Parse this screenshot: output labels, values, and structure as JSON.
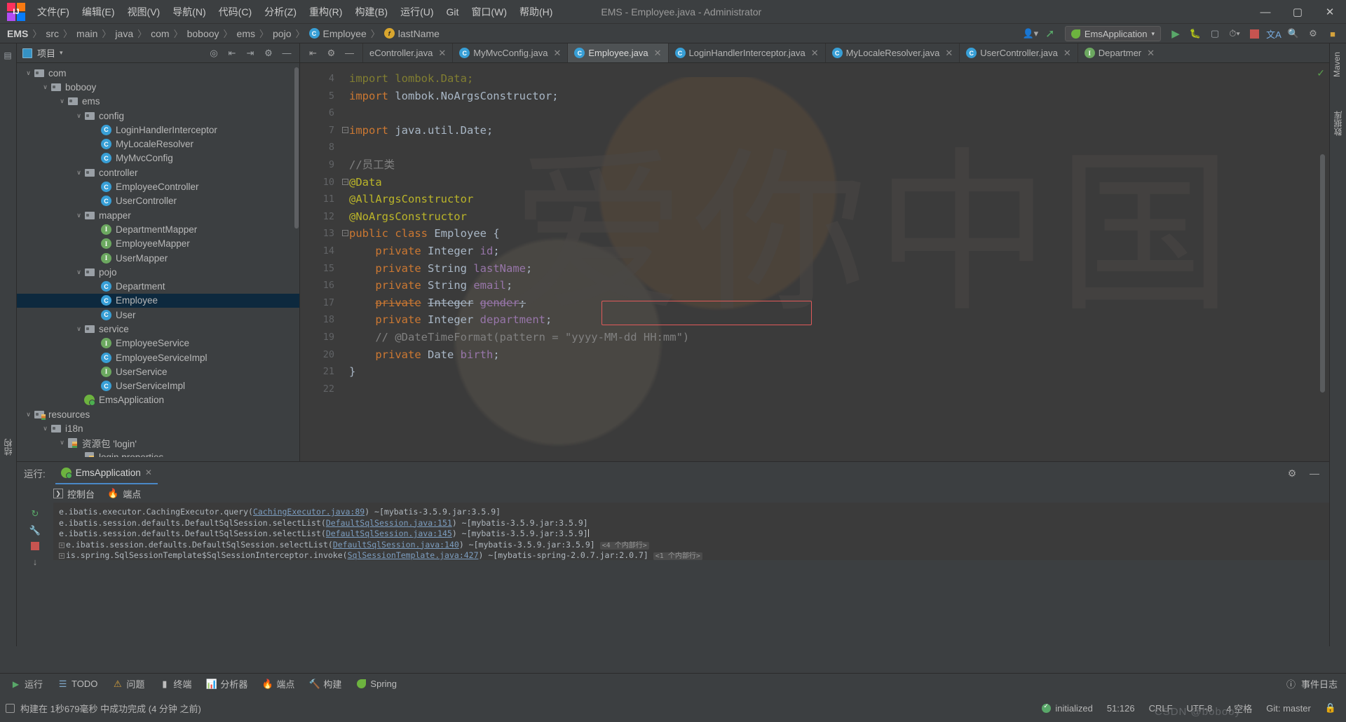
{
  "window": {
    "title": "EMS - Employee.java - Administrator",
    "minimize": "—",
    "maximize": "▢",
    "close": "✕"
  },
  "menubar": {
    "items": [
      {
        "label": "文件(F)"
      },
      {
        "label": "编辑(E)"
      },
      {
        "label": "视图(V)"
      },
      {
        "label": "导航(N)"
      },
      {
        "label": "代码(C)"
      },
      {
        "label": "分析(Z)"
      },
      {
        "label": "重构(R)"
      },
      {
        "label": "构建(B)"
      },
      {
        "label": "运行(U)"
      },
      {
        "label": "Git"
      },
      {
        "label": "窗口(W)"
      },
      {
        "label": "帮助(H)"
      }
    ]
  },
  "breadcrumb": {
    "items": [
      "EMS",
      "src",
      "main",
      "java",
      "com",
      "bobooy",
      "ems",
      "pojo",
      "Employee",
      "lastName"
    ],
    "class_icon": "C",
    "field_icon": "f",
    "separator": "〉"
  },
  "navbar_right": {
    "run_config": "EmsApplication",
    "icons": [
      "user-icon",
      "hammer-icon",
      "run-icon",
      "debug-icon",
      "coverage-icon",
      "profile-icon",
      "stop-icon",
      "translate-icon",
      "search-icon",
      "settings-icon",
      "plugin-icon"
    ]
  },
  "left_strip": {
    "tabs": [
      "项目",
      "结构"
    ]
  },
  "right_strip": {
    "tabs": [
      "Maven",
      "数据库"
    ]
  },
  "project_panel": {
    "title": "项目",
    "caret": "▾",
    "tools": [
      "target-icon",
      "collapse-icon",
      "expand-icon",
      "gear-icon",
      "minimize-icon"
    ],
    "tree": [
      {
        "depth": 3,
        "arrow": "∨",
        "icon": "folder",
        "label": "com",
        "selected": false
      },
      {
        "depth": 4,
        "arrow": "∨",
        "icon": "folder",
        "label": "bobooy",
        "selected": false
      },
      {
        "depth": 5,
        "arrow": "∨",
        "icon": "folder",
        "label": "ems",
        "selected": false
      },
      {
        "depth": 6,
        "arrow": "∨",
        "icon": "folder",
        "label": "config",
        "selected": false
      },
      {
        "depth": 7,
        "arrow": "",
        "icon": "class",
        "label": "LoginHandlerInterceptor",
        "selected": false
      },
      {
        "depth": 7,
        "arrow": "",
        "icon": "class",
        "label": "MyLocaleResolver",
        "selected": false
      },
      {
        "depth": 7,
        "arrow": "",
        "icon": "class",
        "label": "MyMvcConfig",
        "selected": false
      },
      {
        "depth": 6,
        "arrow": "∨",
        "icon": "folder",
        "label": "controller",
        "selected": false
      },
      {
        "depth": 7,
        "arrow": "",
        "icon": "class",
        "label": "EmployeeController",
        "selected": false
      },
      {
        "depth": 7,
        "arrow": "",
        "icon": "class",
        "label": "UserController",
        "selected": false
      },
      {
        "depth": 6,
        "arrow": "∨",
        "icon": "folder",
        "label": "mapper",
        "selected": false
      },
      {
        "depth": 7,
        "arrow": "",
        "icon": "interface",
        "label": "DepartmentMapper",
        "selected": false
      },
      {
        "depth": 7,
        "arrow": "",
        "icon": "interface",
        "label": "EmployeeMapper",
        "selected": false
      },
      {
        "depth": 7,
        "arrow": "",
        "icon": "interface",
        "label": "UserMapper",
        "selected": false
      },
      {
        "depth": 6,
        "arrow": "∨",
        "icon": "folder",
        "label": "pojo",
        "selected": false
      },
      {
        "depth": 7,
        "arrow": "",
        "icon": "class",
        "label": "Department",
        "selected": false
      },
      {
        "depth": 7,
        "arrow": "",
        "icon": "class",
        "label": "Employee",
        "selected": true
      },
      {
        "depth": 7,
        "arrow": "",
        "icon": "class",
        "label": "User",
        "selected": false
      },
      {
        "depth": 6,
        "arrow": "∨",
        "icon": "folder",
        "label": "service",
        "selected": false
      },
      {
        "depth": 7,
        "arrow": "",
        "icon": "interface",
        "label": "EmployeeService",
        "selected": false
      },
      {
        "depth": 7,
        "arrow": "",
        "icon": "class",
        "label": "EmployeeServiceImpl",
        "selected": false
      },
      {
        "depth": 7,
        "arrow": "",
        "icon": "interface",
        "label": "UserService",
        "selected": false
      },
      {
        "depth": 7,
        "arrow": "",
        "icon": "class",
        "label": "UserServiceImpl",
        "selected": false
      },
      {
        "depth": 6,
        "arrow": "",
        "icon": "spring",
        "label": "EmsApplication",
        "selected": false
      },
      {
        "depth": 3,
        "arrow": "∨",
        "icon": "resfolder",
        "label": "resources",
        "selected": false
      },
      {
        "depth": 4,
        "arrow": "∨",
        "icon": "folder",
        "label": "i18n",
        "selected": false
      },
      {
        "depth": 5,
        "arrow": "∨",
        "icon": "properties",
        "label": "资源包 'login'",
        "selected": false
      },
      {
        "depth": 6,
        "arrow": "",
        "icon": "properties",
        "label": "login.properties",
        "selected": false
      }
    ]
  },
  "editor": {
    "tabs": [
      {
        "label": "eController.java",
        "icon": "class",
        "active": false,
        "truncated": true
      },
      {
        "label": "MyMvcConfig.java",
        "icon": "class",
        "active": false
      },
      {
        "label": "Employee.java",
        "icon": "class",
        "active": true
      },
      {
        "label": "LoginHandlerInterceptor.java",
        "icon": "class",
        "active": false
      },
      {
        "label": "MyLocaleResolver.java",
        "icon": "class",
        "active": false
      },
      {
        "label": "UserController.java",
        "icon": "class",
        "active": false
      },
      {
        "label": "Departmer",
        "icon": "interface",
        "active": false,
        "truncated": true
      }
    ],
    "tab_tools": [
      "collapse-icon",
      "gear-icon",
      "minimize-icon"
    ],
    "close_glyph": "✕",
    "lines": [
      {
        "num": "4",
        "html": "<span class=\"ann\">import lombok.Data;</span>",
        "fold": false,
        "dim": true
      },
      {
        "num": "5",
        "html": "<span class=\"kw\">import</span> lombok.NoArgsConstructor;",
        "fold": false
      },
      {
        "num": "6",
        "html": "",
        "fold": false
      },
      {
        "num": "7",
        "html": "<span class=\"kw\">import</span> java.util.Date;",
        "fold": true
      },
      {
        "num": "8",
        "html": "",
        "fold": false
      },
      {
        "num": "9",
        "html": "<span class=\"cmt\">//员工类</span>",
        "fold": false
      },
      {
        "num": "10",
        "html": "<span class=\"ann\">@Data</span>",
        "fold": true
      },
      {
        "num": "11",
        "html": "<span class=\"ann\">@AllArgsConstructor</span>",
        "fold": false
      },
      {
        "num": "12",
        "html": "<span class=\"ann\">@NoArgsConstructor</span>",
        "fold": false
      },
      {
        "num": "13",
        "html": "<span class=\"kw\">public class</span> <span class=\"cls\">Employee</span> {",
        "fold": true
      },
      {
        "num": "14",
        "html": "    <span class=\"kw\">private</span> <span class=\"typ\">Integer</span> <span class=\"fld\">id</span>;",
        "fold": false
      },
      {
        "num": "15",
        "html": "    <span class=\"kw\">private</span> <span class=\"typ\">String</span> <span class=\"fld\">lastName</span>;",
        "fold": false
      },
      {
        "num": "16",
        "html": "    <span class=\"kw\">private</span> <span class=\"typ\">String</span> <span class=\"fld\">email</span>;",
        "fold": false
      },
      {
        "num": "17",
        "html": "    <span class=\"kw strike\">private</span> <span class=\"typ strike\">Integer</span> <span class=\"fld strike\">gender</span><span class=\"strike\">;</span>",
        "fold": false
      },
      {
        "num": "18",
        "html": "    <span class=\"kw\">private</span> <span class=\"typ\">Integer</span> <span class=\"fld\">department</span>;",
        "fold": false
      },
      {
        "num": "19",
        "html": "    <span class=\"cmt\">// @DateTimeFormat(pattern = \"yyyy-MM-dd HH:mm\")</span>",
        "fold": false
      },
      {
        "num": "20",
        "html": "    <span class=\"kw\">private</span> <span class=\"typ\">Date</span> <span class=\"fld\">birth</span>;",
        "fold": false
      },
      {
        "num": "21",
        "html": "}",
        "fold": false
      },
      {
        "num": "22",
        "html": "",
        "fold": false
      }
    ],
    "watermark_text": "爱你中国",
    "inspection_status": "✓"
  },
  "run_panel": {
    "label": "运行:",
    "tab": "EmsApplication",
    "tab_close": "✕",
    "subtabs": [
      {
        "label": "控制台",
        "icon": "console-icon"
      },
      {
        "label": "端点",
        "icon": "endpoints-icon"
      }
    ],
    "header_icons": [
      "settings-icon",
      "minimize-icon"
    ],
    "gutter_icons": [
      "rerun-icon",
      "up-icon",
      "wrench-icon",
      "stop-icon",
      "down-icon",
      "chevrons-icon"
    ],
    "console_lines": [
      {
        "pre": "e.ibatis.executor.CachingExecutor.query(",
        "link": "CachingExecutor.java:89",
        "post": ") ~[mybatis-3.5.9.jar:3.5.9]",
        "fold": false,
        "tag": "",
        "caret": false
      },
      {
        "pre": "e.ibatis.session.defaults.DefaultSqlSession.selectList(",
        "link": "DefaultSqlSession.java:151",
        "post": ") ~[mybatis-3.5.9.jar:3.5.9]",
        "fold": false,
        "tag": "",
        "caret": false
      },
      {
        "pre": "e.ibatis.session.defaults.DefaultSqlSession.selectList(",
        "link": "DefaultSqlSession.java:145",
        "post": ") ~[mybatis-3.5.9.jar:3.5.9]",
        "fold": false,
        "tag": "",
        "caret": true
      },
      {
        "pre": "e.ibatis.session.defaults.DefaultSqlSession.selectList(",
        "link": "DefaultSqlSession.java:140",
        "post": ") ~[mybatis-3.5.9.jar:3.5.9]",
        "fold": true,
        "tag": "<4 个内部行>",
        "caret": false
      },
      {
        "pre": "is.spring.SqlSessionTemplate$SqlSessionInterceptor.invoke(",
        "link": "SqlSessionTemplate.java:427",
        "post": ") ~[mybatis-spring-2.0.7.jar:2.0.7]",
        "fold": true,
        "tag": "<1 个内部行>",
        "caret": false
      }
    ]
  },
  "bottom_bar": {
    "tabs": [
      {
        "label": "运行",
        "icon": "run-icon"
      },
      {
        "label": "TODO",
        "icon": "todo-icon"
      },
      {
        "label": "问题",
        "icon": "problems-icon"
      },
      {
        "label": "终端",
        "icon": "terminal-icon"
      },
      {
        "label": "分析器",
        "icon": "profiler-icon"
      },
      {
        "label": "端点",
        "icon": "endpoints-icon"
      },
      {
        "label": "构建",
        "icon": "build-icon"
      },
      {
        "label": "Spring",
        "icon": "spring-icon"
      }
    ],
    "right": [
      {
        "label": "事件日志",
        "icon": "event-log-icon"
      }
    ]
  },
  "status_bar": {
    "message": "构建在 1秒679毫秒 中成功完成 (4 分钟 之前)",
    "right": [
      {
        "label": "initialized",
        "icon": "check-icon"
      },
      {
        "label": "51:126"
      },
      {
        "label": "CRLF"
      },
      {
        "label": "UTF-8"
      },
      {
        "label": "4 空格"
      },
      {
        "label": "Git: master"
      },
      {
        "label": "🔒"
      }
    ],
    "watermark": "CSDN @bobooy"
  }
}
